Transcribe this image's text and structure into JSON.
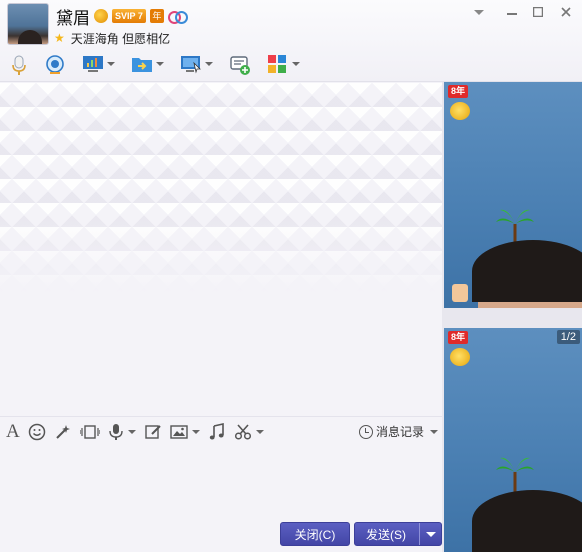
{
  "header": {
    "nickname": "黛眉",
    "vip_badge": "SVIP 7",
    "year_badge": "年",
    "signature": "天涯海角 但愿相亿",
    "window_controls": [
      "chevron-down-icon",
      "minimize-icon",
      "maximize-icon",
      "close-icon"
    ]
  },
  "toolbar": {
    "items": [
      {
        "name": "voice-call",
        "icon": "microphone-icon",
        "dropdown": false
      },
      {
        "name": "video-call",
        "icon": "webcam-icon",
        "dropdown": false
      },
      {
        "name": "screen-share",
        "icon": "presentation-icon",
        "dropdown": true
      },
      {
        "name": "send-file",
        "icon": "folder-arrow-icon",
        "dropdown": true
      },
      {
        "name": "remote-assist",
        "icon": "remote-desktop-icon",
        "dropdown": true
      },
      {
        "name": "new-discussion",
        "icon": "chat-add-icon",
        "dropdown": false
      },
      {
        "name": "apps",
        "icon": "apps-grid-icon",
        "dropdown": true
      }
    ]
  },
  "input_toolbar": {
    "items": [
      {
        "name": "font",
        "icon": "font-icon",
        "glyph": "A"
      },
      {
        "name": "emoji",
        "icon": "smiley-icon",
        "glyph": "☺"
      },
      {
        "name": "magic",
        "icon": "magic-wand-icon",
        "glyph": "✦"
      },
      {
        "name": "shake",
        "icon": "shake-window-icon",
        "glyph": "⟦⟧"
      },
      {
        "name": "voice-message",
        "icon": "microphone-icon",
        "glyph": "🎙"
      },
      {
        "name": "doodle",
        "icon": "edit-icon",
        "glyph": "✎"
      },
      {
        "name": "image",
        "icon": "image-icon",
        "glyph": "▣"
      },
      {
        "name": "music",
        "icon": "music-note-icon",
        "glyph": "♫"
      },
      {
        "name": "screenshot",
        "icon": "scissors-icon",
        "glyph": "✂"
      }
    ],
    "history_label": "消息记录"
  },
  "buttons": {
    "close_label": "关闭(C)",
    "send_label": "发送(S)"
  },
  "video_panels": [
    {
      "badge": "8年",
      "page_indicator": ""
    },
    {
      "badge": "8年",
      "page_indicator": "1/2"
    }
  ],
  "colors": {
    "accent": "#4a4db0",
    "vip_orange": "#e47c05",
    "video_bg": "#4b80b3"
  }
}
